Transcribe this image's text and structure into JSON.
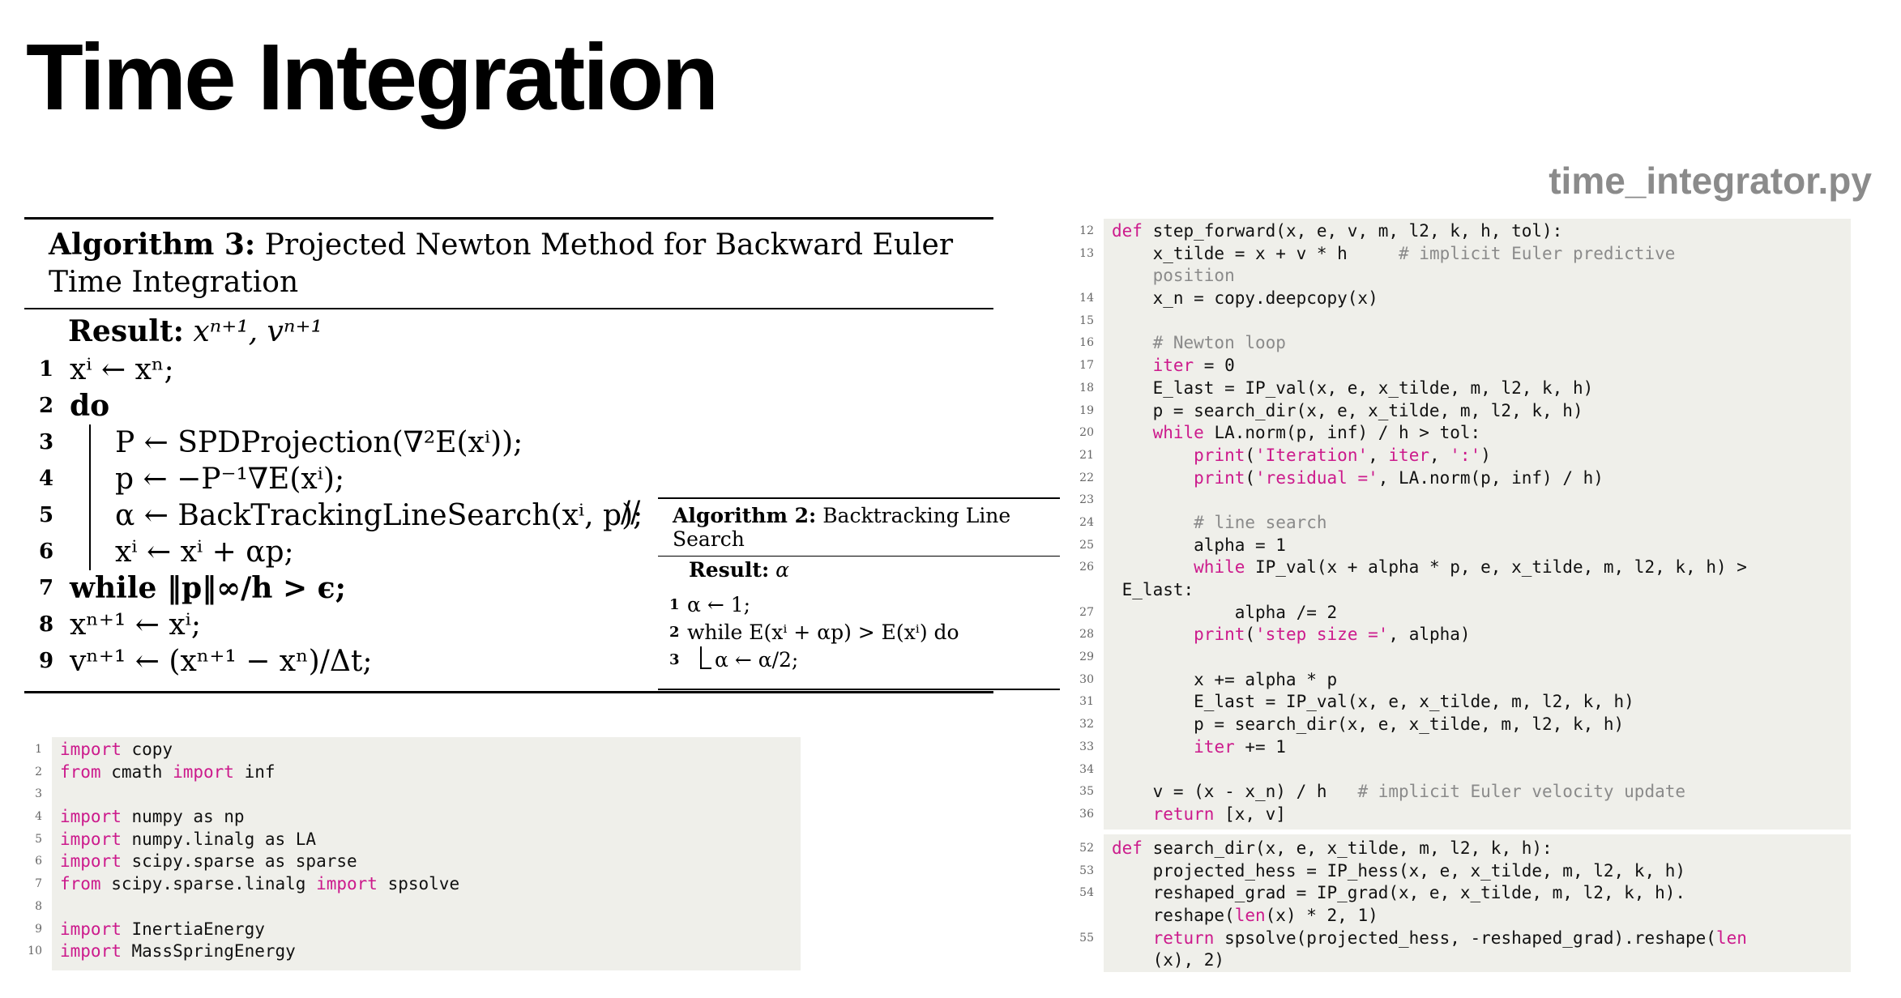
{
  "title": "Time Integration",
  "filename": "time_integrator.py",
  "algorithm3": {
    "label": "Algorithm 3:",
    "title_line1": "Projected Newton Method for Backward Euler",
    "title_line2": "Time Integration",
    "result_label": "Result:",
    "result_value": "xⁿ⁺¹, vⁿ⁺¹",
    "lines": [
      {
        "num": "1",
        "text": "xⁱ ← xⁿ;"
      },
      {
        "num": "2",
        "text": "do"
      },
      {
        "num": "3",
        "text": "P ← SPDProjection(∇²E(xⁱ));"
      },
      {
        "num": "4",
        "text": "p ← −P⁻¹∇E(xⁱ);"
      },
      {
        "num": "5",
        "text": "α ← BackTrackingLineSearch(xⁱ, p);"
      },
      {
        "num": "6",
        "text": "xⁱ ← xⁱ + αp;"
      },
      {
        "num": "7",
        "text": "while ‖p‖∞/h > ϵ;"
      },
      {
        "num": "8",
        "text": "xⁿ⁺¹ ← xⁱ;"
      },
      {
        "num": "9",
        "text": "vⁿ⁺¹ ← (xⁿ⁺¹ − xⁿ)/Δt;"
      }
    ],
    "comment_marker": "//"
  },
  "algorithm2": {
    "label": "Algorithm 2:",
    "title": "Backtracking Line Search",
    "result_label": "Result:",
    "result_value": "α",
    "lines": [
      {
        "num": "1",
        "text": "α ← 1;"
      },
      {
        "num": "2",
        "text": "while E(xⁱ + αp) > E(xⁱ) do"
      },
      {
        "num": "3",
        "text": "α ← α/2;"
      }
    ]
  },
  "imports_code": [
    {
      "n": "1",
      "t": "import copy"
    },
    {
      "n": "2",
      "t": "from cmath import inf"
    },
    {
      "n": "3",
      "t": ""
    },
    {
      "n": "4",
      "t": "import numpy as np"
    },
    {
      "n": "5",
      "t": "import numpy.linalg as LA"
    },
    {
      "n": "6",
      "t": "import scipy.sparse as sparse"
    },
    {
      "n": "7",
      "t": "from scipy.sparse.linalg import spsolve"
    },
    {
      "n": "8",
      "t": ""
    },
    {
      "n": "9",
      "t": "import InertiaEnergy"
    },
    {
      "n": "10",
      "t": "import MassSpringEnergy"
    }
  ],
  "step_forward_code": [
    {
      "n": "12",
      "t": "def step_forward(x, e, v, m, l2, k, h, tol):"
    },
    {
      "n": "13",
      "t": "    x_tilde = x + v * h     # implicit Euler predictive"
    },
    {
      "n": "",
      "t": "    position"
    },
    {
      "n": "14",
      "t": "    x_n = copy.deepcopy(x)"
    },
    {
      "n": "15",
      "t": ""
    },
    {
      "n": "16",
      "t": "    # Newton loop"
    },
    {
      "n": "17",
      "t": "    iter = 0"
    },
    {
      "n": "18",
      "t": "    E_last = IP_val(x, e, x_tilde, m, l2, k, h)"
    },
    {
      "n": "19",
      "t": "    p = search_dir(x, e, x_tilde, m, l2, k, h)"
    },
    {
      "n": "20",
      "t": "    while LA.norm(p, inf) / h > tol:"
    },
    {
      "n": "21",
      "t": "        print('Iteration', iter, ':')"
    },
    {
      "n": "22",
      "t": "        print('residual =', LA.norm(p, inf) / h)"
    },
    {
      "n": "23",
      "t": ""
    },
    {
      "n": "24",
      "t": "        # line search"
    },
    {
      "n": "25",
      "t": "        alpha = 1"
    },
    {
      "n": "26",
      "t": "        while IP_val(x + alpha * p, e, x_tilde, m, l2, k, h) >"
    },
    {
      "n": "",
      "t": " E_last:"
    },
    {
      "n": "27",
      "t": "            alpha /= 2"
    },
    {
      "n": "28",
      "t": "        print('step size =', alpha)"
    },
    {
      "n": "29",
      "t": ""
    },
    {
      "n": "30",
      "t": "        x += alpha * p"
    },
    {
      "n": "31",
      "t": "        E_last = IP_val(x, e, x_tilde, m, l2, k, h)"
    },
    {
      "n": "32",
      "t": "        p = search_dir(x, e, x_tilde, m, l2, k, h)"
    },
    {
      "n": "33",
      "t": "        iter += 1"
    },
    {
      "n": "34",
      "t": ""
    },
    {
      "n": "35",
      "t": "    v = (x - x_n) / h   # implicit Euler velocity update"
    },
    {
      "n": "36",
      "t": "    return [x, v]"
    }
  ],
  "search_dir_code": [
    {
      "n": "52",
      "t": "def search_dir(x, e, x_tilde, m, l2, k, h):"
    },
    {
      "n": "53",
      "t": "    projected_hess = IP_hess(x, e, x_tilde, m, l2, k, h)"
    },
    {
      "n": "54",
      "t": "    reshaped_grad = IP_grad(x, e, x_tilde, m, l2, k, h)."
    },
    {
      "n": "",
      "t": "    reshape(len(x) * 2, 1)"
    },
    {
      "n": "55",
      "t": "    return spsolve(projected_hess, -reshaped_grad).reshape(len"
    },
    {
      "n": "",
      "t": "    (x), 2)"
    }
  ],
  "colors": {
    "keyword": "#cc1a8c",
    "comment": "#8a8a8a",
    "code_bg": "#efefea",
    "filename": "#8b8b8b"
  }
}
